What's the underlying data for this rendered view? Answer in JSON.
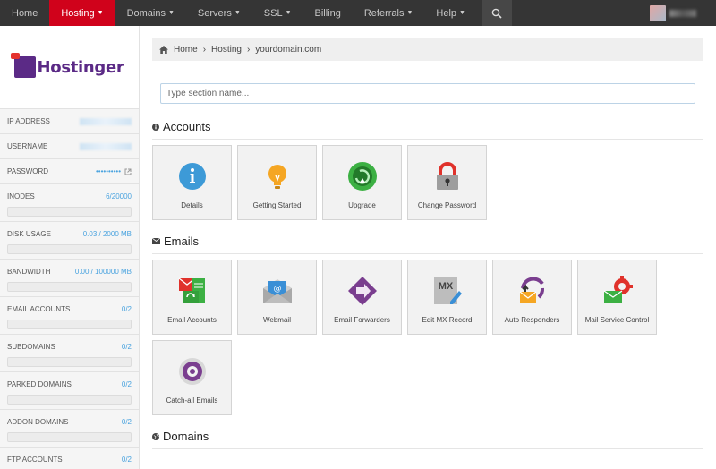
{
  "topnav": {
    "items": [
      {
        "label": "Home",
        "caret": false,
        "active": false
      },
      {
        "label": "Hosting",
        "caret": true,
        "active": true
      },
      {
        "label": "Domains",
        "caret": true,
        "active": false
      },
      {
        "label": "Servers",
        "caret": true,
        "active": false
      },
      {
        "label": "SSL",
        "caret": true,
        "active": false
      },
      {
        "label": "Billing",
        "caret": false,
        "active": false
      },
      {
        "label": "Referrals",
        "caret": true,
        "active": false
      },
      {
        "label": "Help",
        "caret": true,
        "active": false
      }
    ],
    "active_color": "#d0021b"
  },
  "sidebar": {
    "logo": "Hostinger",
    "ip_label": "IP ADDRESS",
    "username_label": "USERNAME",
    "password_label": "PASSWORD",
    "password_value": "••••••••••",
    "stats": [
      {
        "label": "INODES",
        "value": "6/20000"
      },
      {
        "label": "DISK USAGE",
        "value": "0.03 / 2000 MB"
      },
      {
        "label": "BANDWIDTH",
        "value": "0.00 / 100000 MB"
      },
      {
        "label": "EMAIL ACCOUNTS",
        "value": "0/2"
      },
      {
        "label": "SUBDOMAINS",
        "value": "0/2"
      },
      {
        "label": "PARKED DOMAINS",
        "value": "0/2"
      },
      {
        "label": "ADDON DOMAINS",
        "value": "0/2"
      },
      {
        "label": "FTP ACCOUNTS",
        "value": "0/2"
      }
    ]
  },
  "breadcrumb": {
    "home": "Home",
    "sep": "›",
    "hosting": "Hosting",
    "domain": "yourdomain.com"
  },
  "search": {
    "placeholder": "Type section name..."
  },
  "sections": {
    "accounts": {
      "title": "Accounts",
      "tiles": [
        {
          "label": "Details",
          "icon": "info-icon"
        },
        {
          "label": "Getting Started",
          "icon": "lightbulb-icon"
        },
        {
          "label": "Upgrade",
          "icon": "upgrade-icon"
        },
        {
          "label": "Change Password",
          "icon": "lock-icon"
        }
      ]
    },
    "emails": {
      "title": "Emails",
      "tiles": [
        {
          "label": "Email Accounts",
          "icon": "email-accounts-icon"
        },
        {
          "label": "Webmail",
          "icon": "webmail-icon"
        },
        {
          "label": "Email Forwarders",
          "icon": "forwarder-icon"
        },
        {
          "label": "Edit MX Record",
          "icon": "mx-record-icon",
          "badge": "MX"
        },
        {
          "label": "Auto Responders",
          "icon": "auto-responder-icon"
        },
        {
          "label": "Mail Service Control",
          "icon": "mail-service-icon"
        },
        {
          "label": "Catch-all Emails",
          "icon": "catch-all-icon"
        }
      ]
    },
    "domains": {
      "title": "Domains"
    }
  }
}
